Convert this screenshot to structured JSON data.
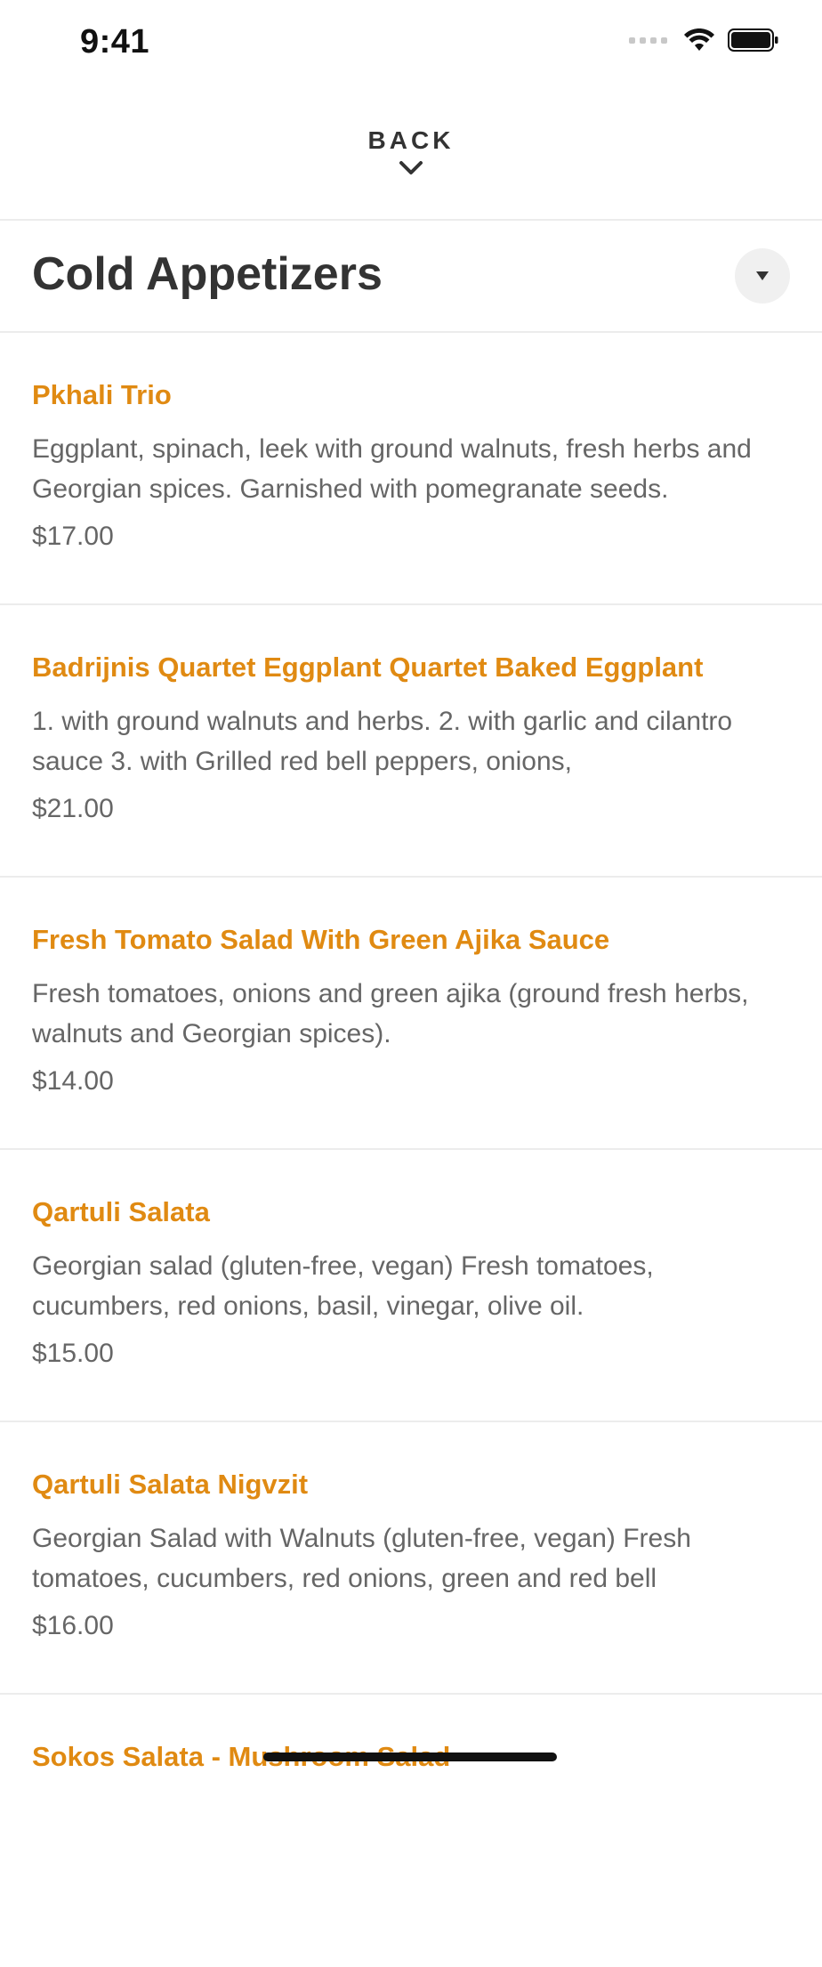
{
  "status_bar": {
    "time": "9:41"
  },
  "navigation": {
    "back_label": "BACK"
  },
  "section": {
    "title": "Cold Appetizers"
  },
  "menu_items": [
    {
      "name": "Pkhali Trio",
      "description": "Eggplant, spinach, leek with ground walnuts, fresh herbs and Georgian spices. Garnished with pomegranate seeds.",
      "price": "$17.00"
    },
    {
      "name": "Badrijnis Quartet Eggplant Quartet Baked Eggplant",
      "description": "1. with ground walnuts and herbs. 2. with garlic and cilantro sauce 3. with Grilled red bell peppers, onions,",
      "price": "$21.00"
    },
    {
      "name": "Fresh Tomato Salad With Green Ajika Sauce",
      "description": "Fresh tomatoes, onions and green ajika (ground fresh herbs, walnuts and Georgian spices).",
      "price": "$14.00"
    },
    {
      "name": "Qartuli Salata",
      "description": "Georgian salad (gluten-free, vegan) Fresh tomatoes, cucumbers, red onions, basil, vinegar, olive oil.",
      "price": "$15.00"
    },
    {
      "name": "Qartuli Salata Nigvzit",
      "description": "Georgian Salad with Walnuts (gluten-free, vegan) Fresh tomatoes, cucumbers, red onions, green and red bell",
      "price": "$16.00"
    },
    {
      "name": "Sokos Salata - Mushroom Salad",
      "description": "",
      "price": ""
    }
  ],
  "colors": {
    "accent": "#e08a12",
    "text_primary": "#333333",
    "text_secondary": "#666666",
    "divider": "#ececec"
  },
  "icons": {
    "back": "chevron-down-icon",
    "collapse": "caret-down-icon",
    "wifi": "wifi-icon",
    "battery": "battery-icon",
    "signal": "cellular-signal-icon"
  }
}
